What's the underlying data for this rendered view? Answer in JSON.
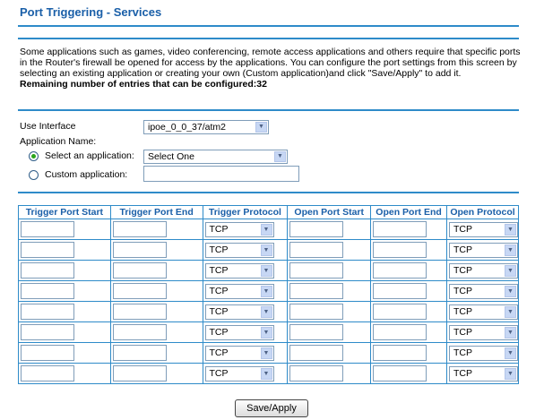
{
  "page": {
    "title": "Port Triggering - Services"
  },
  "description": {
    "text": "Some applications such as games, video conferencing, remote access applications and others require that specific ports in the Router's firewall be opened for access by the applications. You can configure the port settings from this screen by selecting an existing application or creating your own (Custom application)and click \"Save/Apply\" to add it.",
    "remaining": "Remaining number of entries that can be configured:32"
  },
  "form": {
    "interface_label": "Use Interface",
    "interface_value": "ipoe_0_0_37/atm2",
    "app_name_label": "Application Name:",
    "select_app_label": "Select an application:",
    "select_app_value": "Select One",
    "custom_app_label": "Custom application:",
    "selected_option": "select"
  },
  "table": {
    "headers": [
      "Trigger Port Start",
      "Trigger Port End",
      "Trigger Protocol",
      "Open Port Start",
      "Open Port End",
      "Open Protocol"
    ],
    "rows": [
      {
        "trigger_protocol": "TCP",
        "open_protocol": "TCP"
      },
      {
        "trigger_protocol": "TCP",
        "open_protocol": "TCP"
      },
      {
        "trigger_protocol": "TCP",
        "open_protocol": "TCP"
      },
      {
        "trigger_protocol": "TCP",
        "open_protocol": "TCP"
      },
      {
        "trigger_protocol": "TCP",
        "open_protocol": "TCP"
      },
      {
        "trigger_protocol": "TCP",
        "open_protocol": "TCP"
      },
      {
        "trigger_protocol": "TCP",
        "open_protocol": "TCP"
      },
      {
        "trigger_protocol": "TCP",
        "open_protocol": "TCP"
      }
    ]
  },
  "actions": {
    "save_label": "Save/Apply"
  },
  "colors": {
    "accent": "#2e8bc9",
    "title": "#1a5fa8"
  }
}
